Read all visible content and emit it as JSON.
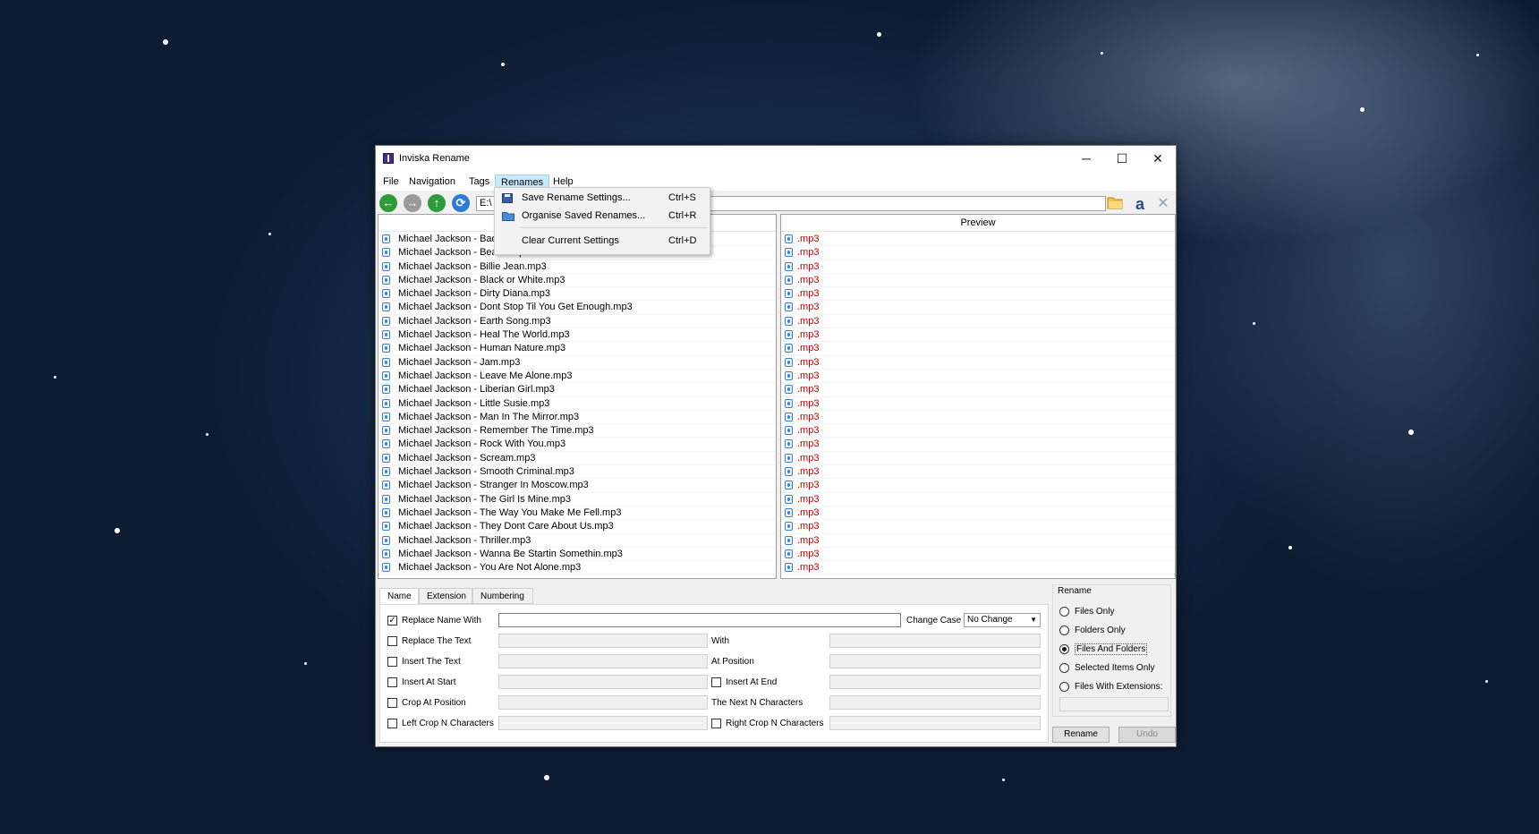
{
  "window": {
    "title": "Inviska Rename",
    "minimize": "─",
    "maximize": "☐",
    "close": "✕"
  },
  "menu": {
    "file": "File",
    "navigation": "Navigation",
    "tags": "Tags",
    "renames": "Renames",
    "help": "Help"
  },
  "renames_menu": [
    {
      "label": "Save Rename Settings...",
      "shortcut": "Ctrl+S",
      "icon": "save-icon"
    },
    {
      "label": "Organise Saved Renames...",
      "shortcut": "Ctrl+R",
      "icon": "folder-icon"
    },
    {
      "label": "Clear Current Settings",
      "shortcut": "Ctrl+D",
      "icon": ""
    }
  ],
  "toolbar": {
    "back": "back-icon",
    "forward": "forward-icon",
    "up": "up-icon",
    "refresh": "refresh-icon",
    "path": "E:\\",
    "browse": "folder-icon",
    "amazon": "amazon-icon",
    "settings": "tools-icon"
  },
  "files_pane": {
    "files": [
      "Michael Jackson - Bad.mp3",
      "Michael Jackson - Beat It.mp3",
      "Michael Jackson - Billie Jean.mp3",
      "Michael Jackson - Black or White.mp3",
      "Michael Jackson - Dirty Diana.mp3",
      "Michael Jackson - Dont Stop Til You Get Enough.mp3",
      "Michael Jackson - Earth Song.mp3",
      "Michael Jackson - Heal The World.mp3",
      "Michael Jackson - Human Nature.mp3",
      "Michael Jackson - Jam.mp3",
      "Michael Jackson - Leave Me Alone.mp3",
      "Michael Jackson - Liberian Girl.mp3",
      "Michael Jackson - Little Susie.mp3",
      "Michael Jackson - Man In The Mirror.mp3",
      "Michael Jackson - Remember The Time.mp3",
      "Michael Jackson - Rock With You.mp3",
      "Michael Jackson - Scream.mp3",
      "Michael Jackson - Smooth Criminal.mp3",
      "Michael Jackson - Stranger In Moscow.mp3",
      "Michael Jackson - The Girl Is Mine.mp3",
      "Michael Jackson - The Way You Make Me Fell.mp3",
      "Michael Jackson - They Dont Care About Us.mp3",
      "Michael Jackson - Thriller.mp3",
      "Michael Jackson - Wanna Be Startin Somethin.mp3",
      "Michael Jackson - You Are Not Alone.mp3"
    ]
  },
  "preview_pane": {
    "header": "Preview",
    "value": ".mp3",
    "count": 25
  },
  "tabs": {
    "name": "Name",
    "extension": "Extension",
    "numbering": "Numbering"
  },
  "name_tab": {
    "replace_name_with": "Replace Name With",
    "replace_name_checked": true,
    "change_case": "Change Case",
    "change_case_value": "No Change",
    "replace_the_text": "Replace The Text",
    "with": "With",
    "insert_the_text": "Insert The Text",
    "at_position": "At Position",
    "insert_at_start": "Insert At Start",
    "insert_at_end": "Insert At End",
    "crop_at_position": "Crop At Position",
    "next_n_characters": "The Next N Characters",
    "left_crop": "Left Crop N Characters",
    "right_crop": "Right Crop N Characters"
  },
  "rename_group": {
    "title": "Rename",
    "options": [
      "Files Only",
      "Folders Only",
      "Files And Folders",
      "Selected Items Only",
      "Files With Extensions:"
    ],
    "selected": "Files And Folders"
  },
  "buttons": {
    "rename": "Rename",
    "undo": "Undo"
  },
  "colors": {
    "menu_highlight": "#cce8ff",
    "preview_text": "#c00000",
    "back": "#2e9b3a",
    "up": "#2e9b3a",
    "refresh": "#2a7bd6",
    "forward": "#9a9a9a"
  }
}
